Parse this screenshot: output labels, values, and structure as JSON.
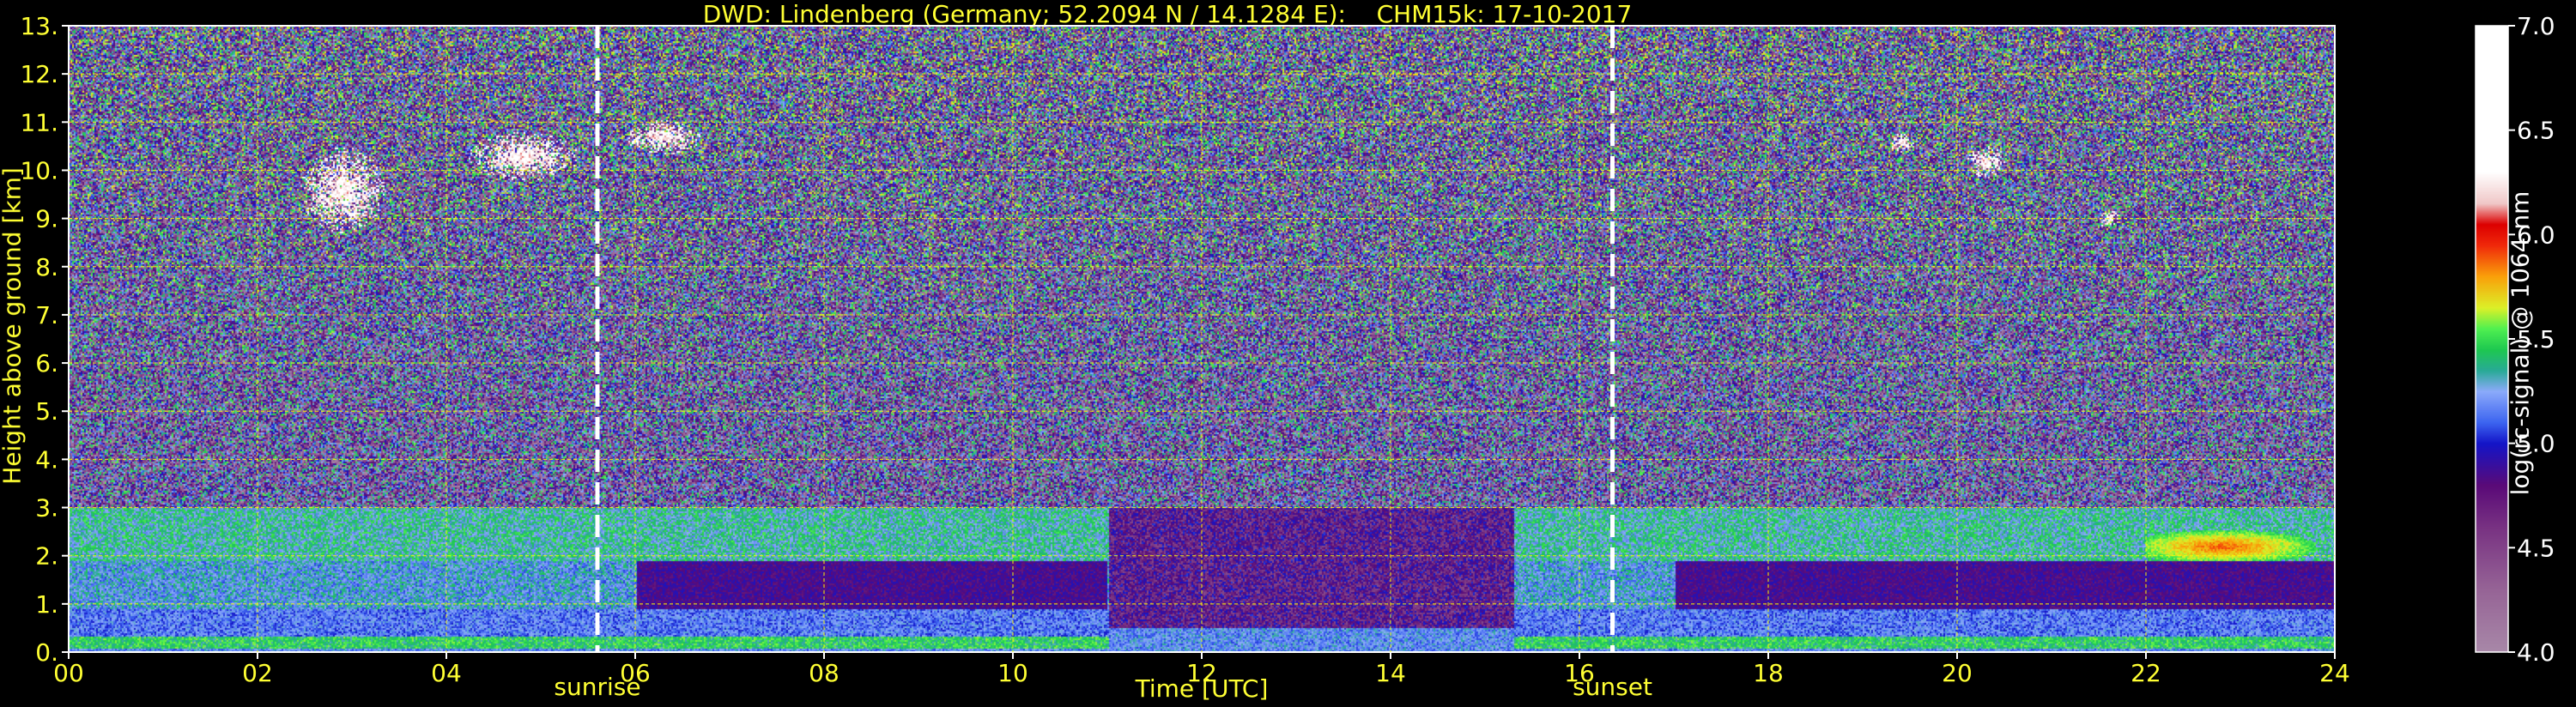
{
  "chart_data": {
    "type": "heatmap",
    "title": "DWD: Lindenberg (Germany; 52.2094 N / 14.1284 E):    CHM15k: 17-10-2017",
    "xlabel": "Time [UTC]",
    "ylabel": "Height above ground [km]",
    "colorbar_label": "log(rc-signal) @ 1064 nm",
    "x_range": [
      0,
      24
    ],
    "x_ticks": [
      "00",
      "02",
      "04",
      "06",
      "08",
      "10",
      "12",
      "14",
      "16",
      "18",
      "20",
      "22",
      "24"
    ],
    "y_range": [
      0,
      13
    ],
    "y_ticks": [
      "0.",
      "1.",
      "2.",
      "3.",
      "4.",
      "5.",
      "6.",
      "7.",
      "8.",
      "9.",
      "10.",
      "11.",
      "12.",
      "13."
    ],
    "colorbar_range": [
      4.0,
      7.0
    ],
    "colorbar_ticks": [
      "4.0",
      "4.5",
      "5.0",
      "5.5",
      "6.0",
      "6.5",
      "7.0"
    ],
    "grid": true,
    "grid_color": "#ffff00",
    "text_color": "#ffff33",
    "markers": [
      {
        "label": "sunrise",
        "time": 5.6
      },
      {
        "label": "sunset",
        "time": 16.35
      }
    ],
    "features": [
      {
        "type": "cirrus cloud",
        "time_start": 1.8,
        "time_end": 6.8,
        "height_start": 8.5,
        "height_end": 11.2
      },
      {
        "type": "cirrus cloud",
        "time_start": 19.3,
        "time_end": 21.8,
        "height_start": 8.8,
        "height_end": 11.0
      },
      {
        "type": "aerosol layer",
        "time_start": 0,
        "time_end": 11.0,
        "height_start": 0.1,
        "height_end": 3.0
      },
      {
        "type": "aerosol layer",
        "time_start": 15.3,
        "time_end": 24,
        "height_start": 0.1,
        "height_end": 3.0
      },
      {
        "type": "strong signal layer",
        "time_start": 22.0,
        "time_end": 24,
        "height_start": 1.9,
        "height_end": 2.6
      }
    ]
  }
}
